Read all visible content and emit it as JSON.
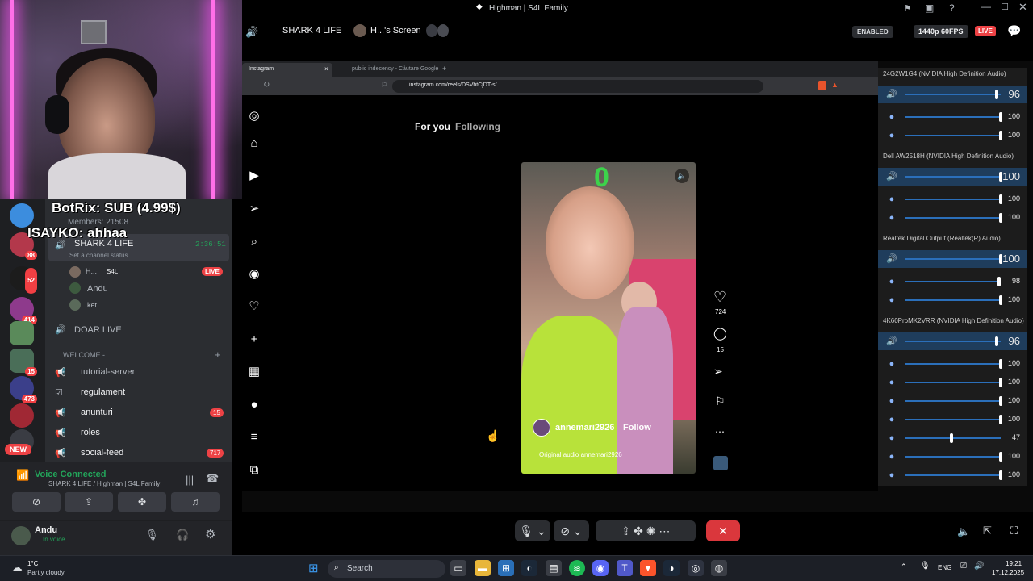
{
  "window": {
    "title": "Highman | S4L Family"
  },
  "stream_header": {
    "server": "SHARK 4 LIFE",
    "screen_label": "H...'s Screen",
    "enabled_badge": "ENABLED",
    "quality": "1440p 60FPS",
    "live_badge": "LIVE"
  },
  "overlay": {
    "line1": "BotRix: SUB (4.99$)",
    "line2": "ISAYKO: ahhaa",
    "members": "Members: 21508"
  },
  "discord": {
    "server_badges": [
      "88",
      "52",
      "414",
      "15",
      "473",
      "717"
    ],
    "new_badge": "NEW",
    "voice_channel": {
      "name": "SHARK 4 LIFE",
      "time": "2:36:51",
      "status": "Set a channel status"
    },
    "members": [
      {
        "name": "H...",
        "tag": "S4L",
        "live": "LIVE"
      },
      {
        "name": "Andu"
      },
      {
        "name": "ket"
      }
    ],
    "channel_doar": "DOAR LIVE",
    "category": "WELCOME -",
    "text_channels": [
      {
        "name": "tutorial-server",
        "badge": ""
      },
      {
        "name": "regulament",
        "badge": ""
      },
      {
        "name": "anunturi",
        "badge": "15"
      },
      {
        "name": "roles",
        "badge": ""
      },
      {
        "name": "social-feed",
        "badge": "717"
      }
    ],
    "voice_connected": "Voice Connected",
    "voice_location": "SHARK 4 LIFE / Highman | S4L Family",
    "user": {
      "name": "Andu",
      "status": "In voice"
    }
  },
  "browser": {
    "tab1": "Instagram",
    "tab2": "public indecency - Căutare Google",
    "url": "instagram.com/reels/DSVbtCjDT-s/"
  },
  "instagram": {
    "tabs": [
      "For you",
      "Following"
    ],
    "author": "annemari2926",
    "follow": "Follow",
    "audio": "Original audio  annemari2926",
    "likes": "724",
    "comments": "15"
  },
  "mixer": {
    "devices": [
      {
        "name": "24G2W1G4 (NVIDIA High Definition Audio)",
        "master": "96",
        "apps": [
          "100",
          "100"
        ]
      },
      {
        "name": "Dell AW2518H (NVIDIA High Definition Audio)",
        "master": "100",
        "apps": [
          "100",
          "100"
        ]
      },
      {
        "name": "Realtek Digital Output (Realtek(R) Audio)",
        "master": "100",
        "apps": [
          "98",
          "100"
        ]
      },
      {
        "name": "4K60ProMK2VRR (NVIDIA High Definition Audio)",
        "master": "96",
        "apps": [
          "100",
          "100",
          "100",
          "100",
          "47",
          "100",
          "100"
        ]
      }
    ]
  },
  "taskbar": {
    "weather_temp": "1°C",
    "weather_desc": "Partly cloudy",
    "search_placeholder": "Search",
    "lang": "ENG",
    "time": "19:21",
    "date": "17.12.2025"
  },
  "colors": {
    "discord_bg": "#2b2d31",
    "live_red": "#ed4245",
    "mixer_blue": "#2b6fba",
    "leave_red": "#da373c"
  }
}
